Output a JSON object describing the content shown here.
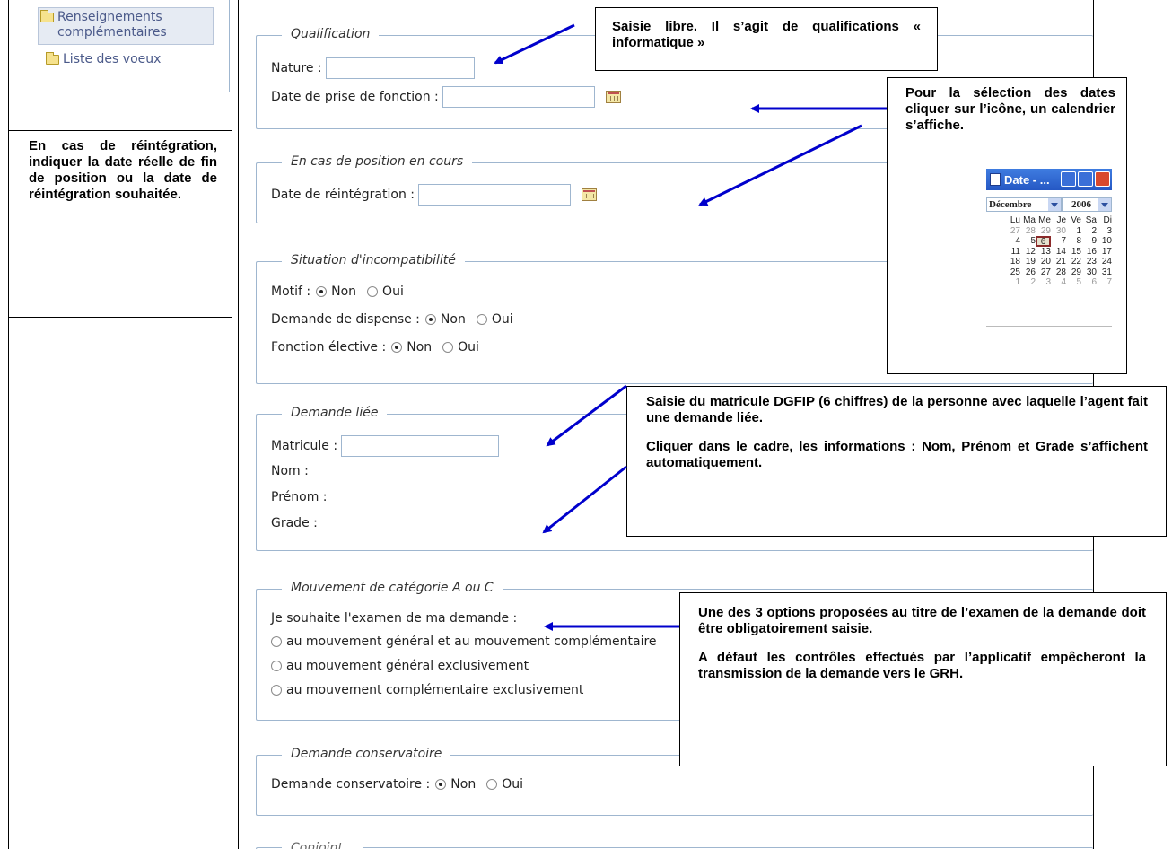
{
  "nav": {
    "items": [
      {
        "label": "Renseignements complémentaires"
      },
      {
        "label": "Liste des voeux"
      }
    ]
  },
  "sections": {
    "qualification": {
      "legend": "Qualification",
      "nature_label": "Nature :",
      "nature_value": "",
      "date_prise_label": "Date de prise de fonction :",
      "date_prise_value": ""
    },
    "position": {
      "legend": "En cas de position en cours",
      "date_reint_label": "Date de réintégration :",
      "date_reint_value": ""
    },
    "incompat": {
      "legend": "Situation d'incompatibilité",
      "rows": [
        {
          "label": "Motif :",
          "selected": "Non"
        },
        {
          "label": "Demande de dispense :",
          "selected": "Non"
        },
        {
          "label": "Fonction élective :",
          "selected": "Non"
        }
      ],
      "opt_non": "Non",
      "opt_oui": "Oui"
    },
    "liee": {
      "legend": "Demande liée",
      "matricule_label": "Matricule :",
      "matricule_value": "",
      "nom_label": "Nom :",
      "prenom_label": "Prénom :",
      "grade_label": "Grade :"
    },
    "mouvement": {
      "legend": "Mouvement de catégorie A ou C",
      "intro": "Je souhaite l'examen de ma demande :",
      "options": [
        "au mouvement général et au mouvement complémentaire",
        "au mouvement général exclusivement",
        "au mouvement complémentaire exclusivement"
      ]
    },
    "conservatoire": {
      "legend": "Demande conservatoire",
      "label": "Demande conservatoire :",
      "selected": "Non"
    },
    "next_partial": {
      "legend": "Conjoint..."
    }
  },
  "callouts": {
    "qualif": "Saisie libre. Il s’agit de qualifications « informatique »",
    "dates": "Pour la sélection des dates cliquer sur l’icône, un calendrier s’affiche.",
    "reint": "En cas de réintégration, indiquer la date réelle de fin de position ou la date de réintégration souhaitée.",
    "liee_p1": "Saisie du matricule DGFIP (6 chiffres) de la personne avec laquelle l’agent fait une demande liée.",
    "liee_p2": "Cliquer dans le cadre, les informations : Nom, Prénom et Grade s’affichent automatiquement.",
    "mouv_p1": "Une des 3 options proposées au titre de l’examen de la demande doit être obligatoirement saisie.",
    "mouv_p2": "A défaut les contrôles effectués par l’applicatif empêcheront la transmission de la demande vers le GRH."
  },
  "calendar": {
    "title": "Date - ...",
    "month": "Décembre",
    "year": "2006",
    "weekdays": [
      "Lu",
      "Ma",
      "Me",
      "Je",
      "Ve",
      "Sa",
      "Di"
    ],
    "weeks": [
      [
        27,
        28,
        29,
        30,
        1,
        2,
        3
      ],
      [
        4,
        5,
        6,
        7,
        8,
        9,
        10
      ],
      [
        11,
        12,
        13,
        14,
        15,
        16,
        17
      ],
      [
        18,
        19,
        20,
        21,
        22,
        23,
        24
      ],
      [
        25,
        26,
        27,
        28,
        29,
        30,
        31
      ],
      [
        1,
        2,
        3,
        4,
        5,
        6,
        7
      ]
    ],
    "selected_day": 6,
    "colors": {
      "titlebar": "#2558c4",
      "selected_border": "#8b2a2a"
    }
  },
  "colors": {
    "arrow": "#0000cc",
    "section_border": "#9fb6cf",
    "nav_text": "#4b5a8a"
  }
}
